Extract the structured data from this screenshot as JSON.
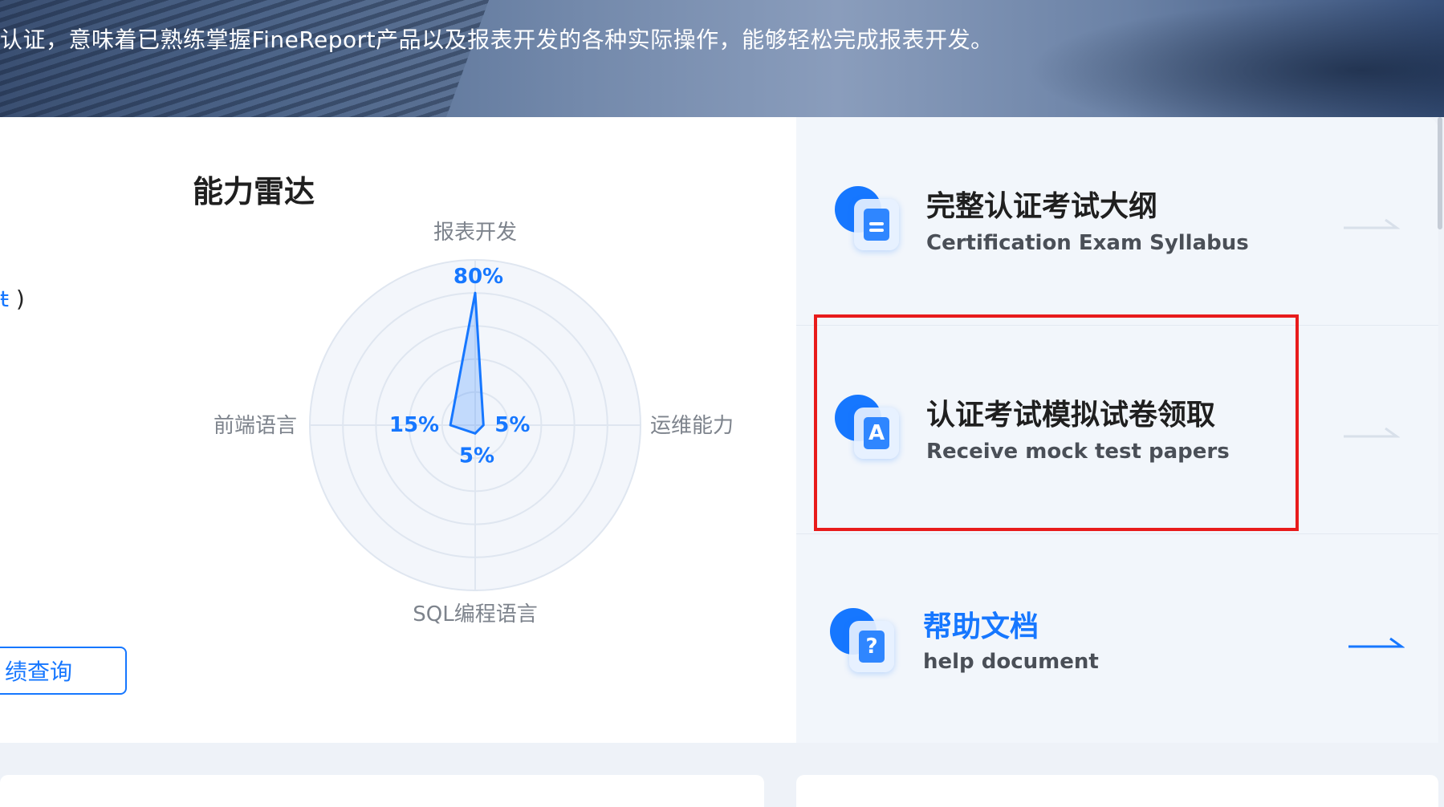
{
  "hero": {
    "text": "认证，意味着已熟练掌握FineReport产品以及报表开发的各种实际操作，能够轻松完成报表开发。"
  },
  "left_panel": {
    "text_fragment": "ŧ",
    "paren": " )",
    "query_button": "绩查询"
  },
  "radar": {
    "title": "能力雷达",
    "accent": "#1677ff"
  },
  "chart_data": {
    "type": "radar",
    "title": "能力雷达",
    "axes": [
      "报表开发",
      "运维能力",
      "SQL编程语言",
      "前端语言"
    ],
    "values": [
      80,
      5,
      5,
      15
    ],
    "value_labels": [
      "80%",
      "5%",
      "5%",
      "15%"
    ],
    "range": [
      0,
      100
    ],
    "grid": true
  },
  "right_panel": {
    "items": [
      {
        "title": "完整认证考试大纲",
        "subtitle": "Certification Exam Syllabus",
        "icon": "document-icon"
      },
      {
        "title": "认证考试模拟试卷领取",
        "subtitle": "Receive mock test papers",
        "icon": "letter-a-icon",
        "glyph": "A"
      },
      {
        "title": "帮助文档",
        "subtitle": "help document",
        "icon": "help-doc-icon",
        "glyph": "?"
      }
    ]
  }
}
